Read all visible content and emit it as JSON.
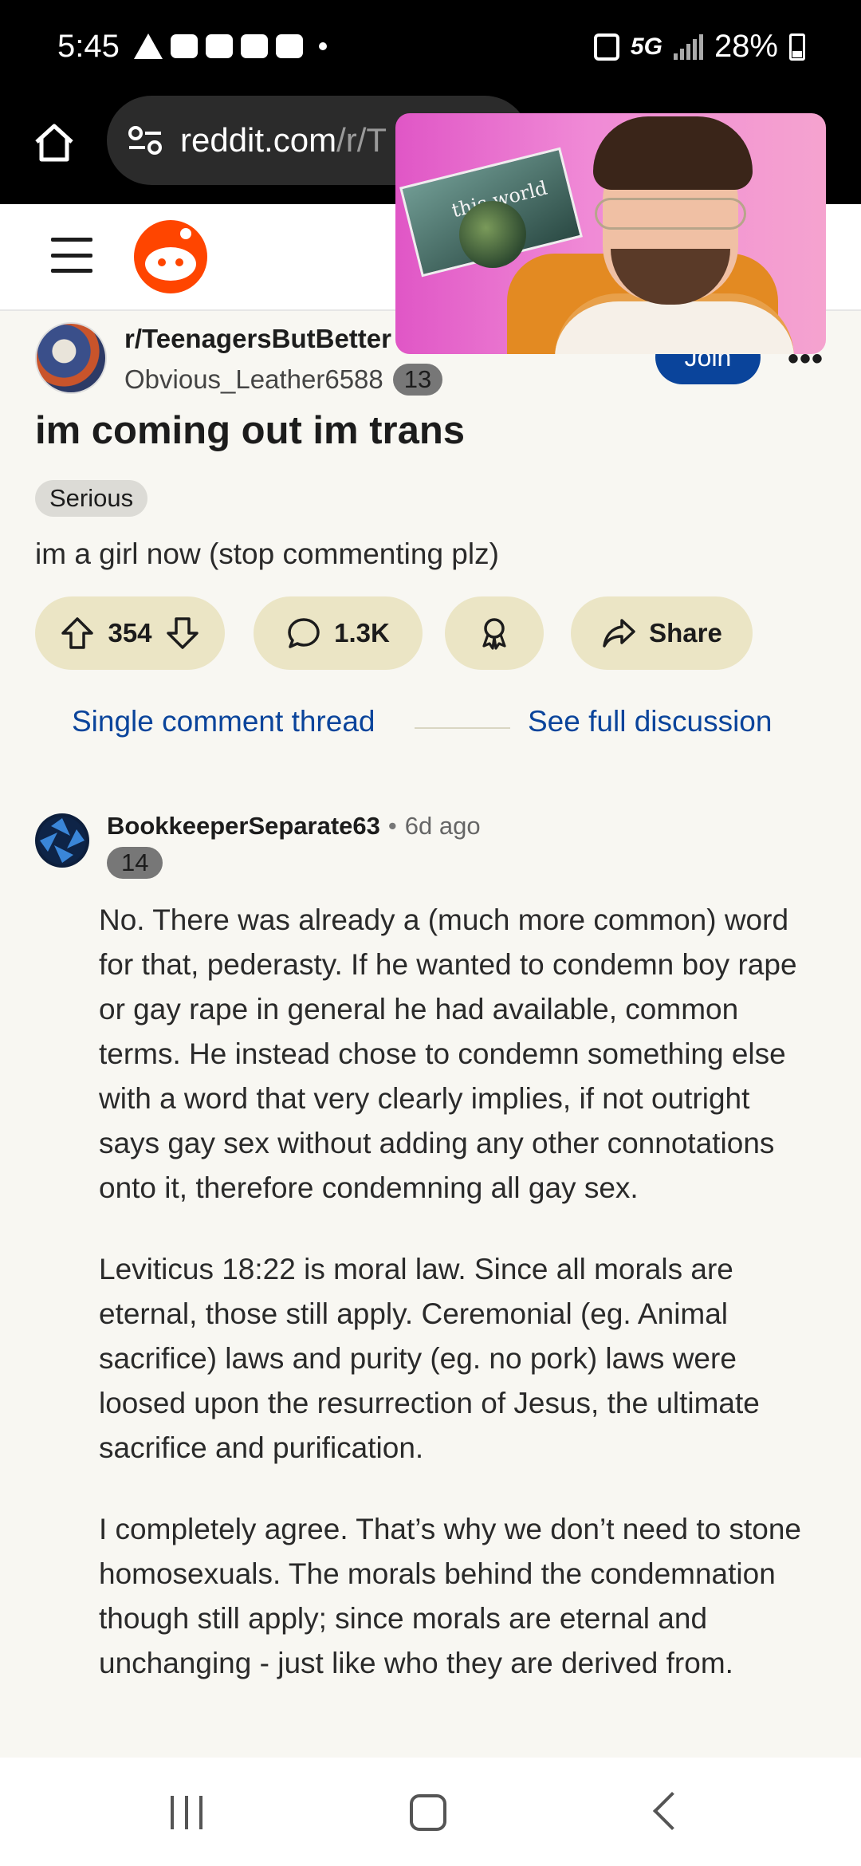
{
  "status_bar": {
    "time": "5:45",
    "network": "5G",
    "battery": "28%"
  },
  "browser": {
    "url_main": "reddit.com",
    "url_path": "/r/T"
  },
  "post": {
    "subreddit": "r/TeenagersButBetter",
    "author": "Obvious_Leather6588",
    "author_flair": "13",
    "join_label": "Join",
    "more_label": "•••",
    "title": "im coming out im trans",
    "flair": "Serious",
    "body": "im a girl now (stop commenting plz)",
    "score": "354",
    "comments": "1.3K",
    "share_label": "Share"
  },
  "thread_nav": {
    "single_label": "Single comment thread",
    "full_label": "See full discussion"
  },
  "comment": {
    "author": "BookkeeperSeparate63",
    "separator": "•",
    "time": "6d ago",
    "flair": "14",
    "paragraphs": [
      "No. There was already a (much more common) word for that, pederasty. If he wanted to condemn boy rape or gay rape in general he had available, common terms. He instead chose to condemn something else with a word that very clearly implies, if not outright says gay sex without adding any other connotations onto it, therefore condemning all gay sex.",
      "Leviticus 18:22 is moral law. Since all morals are eternal, those still apply. Ceremonial (eg. Animal sacrifice) laws and purity (eg. no pork) laws were loosed upon the resurrection of Jesus, the ultimate sacrifice and purification.",
      "I completely agree. That’s why we don’t need to stone homosexuals. The morals behind the condemnation though still apply; since morals are eternal and unchanging - just like who they are derived from."
    ]
  },
  "pip": {
    "card_text": "this world"
  },
  "colors": {
    "reddit_orange": "#ff4500",
    "link_blue": "#0a449b",
    "action_pill": "#ebe5c5"
  },
  "icons": [
    "home-icon",
    "site-settings-icon",
    "menu-icon",
    "reddit-logo",
    "upvote-icon",
    "downvote-icon",
    "comment-icon",
    "award-icon",
    "share-icon",
    "nav-recents-icon",
    "nav-home-icon",
    "nav-back-icon"
  ]
}
